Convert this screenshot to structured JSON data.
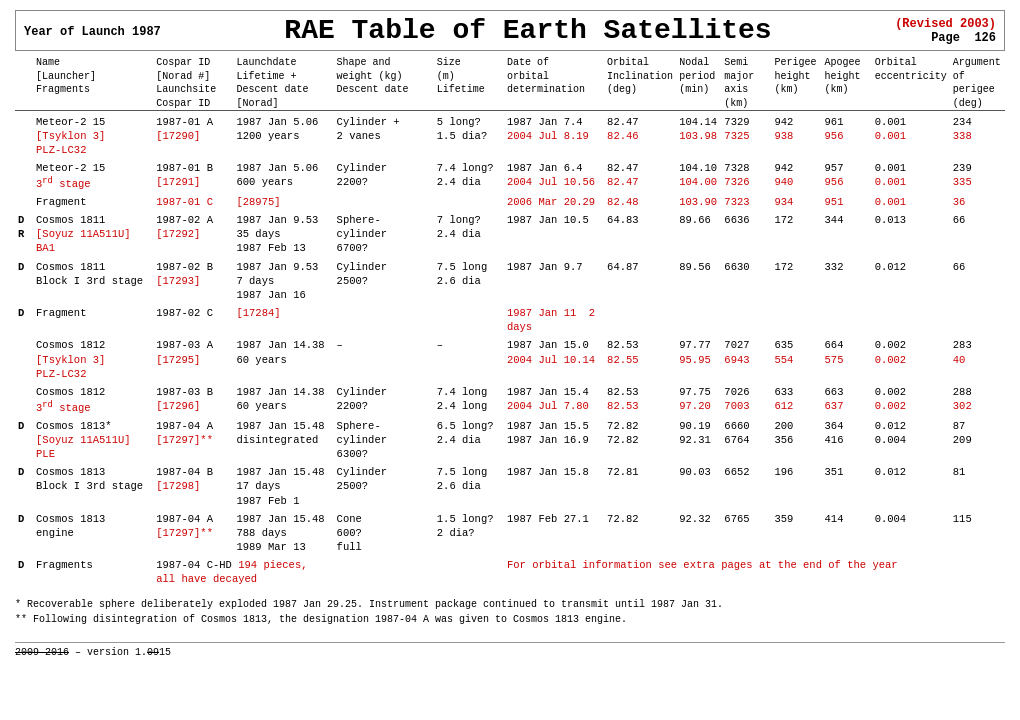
{
  "header": {
    "year_label": "Year of Launch 1987",
    "main_title": "RAE Table of Earth Satellites",
    "revised": "(Revised 2003)",
    "page_label": "Page",
    "page_number": "126"
  },
  "col_headers": {
    "name": "Name\n[Launcher]\nFragments",
    "cospar": "Cospar ID\n[Norad #] Launchsite\nCospar ID",
    "launch": "Launchdate\nLifetime + Descent date\n[Norad]",
    "shape": "Shape and\nweight (kg)\nDescent date",
    "size": "Size\n(m)\nLifetime",
    "date": "Date of\norbital\ndetermination",
    "incl": "Orbital\nInclination\n(deg)",
    "nodal": "Nodal\nperiod\n(min)",
    "semi": "Semi\nmajor axis\n(km)",
    "perigee": "Perigee\nheight\n(km)",
    "apogee": "Apogee\nheight\n(km)",
    "ecc": "Orbital\neccentricity",
    "arg": "Argument\nof perigee\n(deg)"
  },
  "footnotes": {
    "fn1": "*  Recoverable sphere deliberately exploded 1987 Jan 29.25. Instrument package continued to transmit until 1987 Jan 31.",
    "fn2": "** Following disintegration of Cosmos 1813, the designation 1987-04 A was given to Cosmos 1813 engine."
  },
  "version": {
    "text": "2009-2016 – version 1.0915"
  }
}
